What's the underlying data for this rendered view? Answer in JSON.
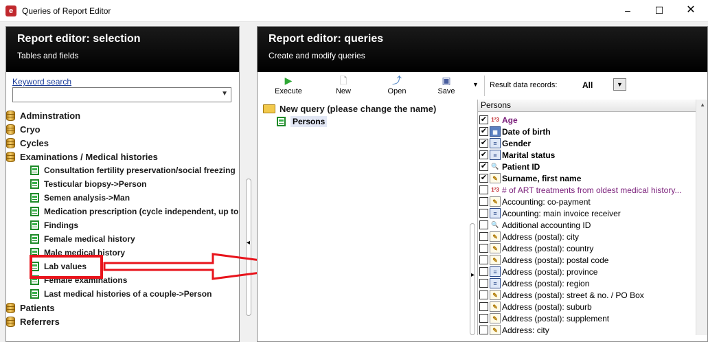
{
  "window": {
    "title": "Queries of Report Editor",
    "minimize": "–",
    "maximize": "☐",
    "close": "✕"
  },
  "left": {
    "title": "Report editor: selection",
    "subtitle": "Tables and fields",
    "keyword_label": "Keyword search",
    "keyword_value": "",
    "tree": [
      {
        "label": "Adminstration",
        "kind": "root"
      },
      {
        "label": "Cryo",
        "kind": "root"
      },
      {
        "label": "Cycles",
        "kind": "root"
      },
      {
        "label": "Examinations / Medical histories",
        "kind": "root"
      },
      {
        "label": "Consultation fertility preservation/social freezing",
        "kind": "child"
      },
      {
        "label": "Testicular biopsy->Person",
        "kind": "child"
      },
      {
        "label": "Semen analysis->Man",
        "kind": "child"
      },
      {
        "label": "Medication prescription (cycle independent, up to",
        "kind": "child"
      },
      {
        "label": "Findings",
        "kind": "child"
      },
      {
        "label": "Female medical history",
        "kind": "child"
      },
      {
        "label": "Male medical history",
        "kind": "child"
      },
      {
        "label": "Lab values",
        "kind": "child"
      },
      {
        "label": "Female examinations",
        "kind": "child"
      },
      {
        "label": "Last medical histories of a couple->Person",
        "kind": "child"
      },
      {
        "label": "Patients",
        "kind": "root"
      },
      {
        "label": "Referrers",
        "kind": "root"
      }
    ]
  },
  "right": {
    "title": "Report editor: queries",
    "subtitle": "Create and modify queries",
    "toolbar": {
      "execute": "Execute",
      "new": "New",
      "open": "Open",
      "save": "Save",
      "result_label": "Result data records:",
      "result_value": "All"
    },
    "query_name": "New query (please change the name)",
    "query_table": "Persons",
    "fields_header": "Persons",
    "fields": [
      {
        "label": "Age",
        "checked": true,
        "icon": "number-icon",
        "style": "bold-purple"
      },
      {
        "label": "Date of birth",
        "checked": true,
        "icon": "date-icon",
        "style": "bold"
      },
      {
        "label": "Gender",
        "checked": true,
        "icon": "list-icon",
        "style": "bold"
      },
      {
        "label": "Marital status",
        "checked": true,
        "icon": "list-icon",
        "style": "bold"
      },
      {
        "label": "Patient ID",
        "checked": true,
        "icon": "key-icon",
        "style": "bold"
      },
      {
        "label": "Surname, first name",
        "checked": true,
        "icon": "text-icon",
        "style": "bold"
      },
      {
        "label": "# of ART treatments from oldest medical history...",
        "checked": false,
        "icon": "number-icon",
        "style": "purple"
      },
      {
        "label": "Accounting: co-payment",
        "checked": false,
        "icon": "text-icon",
        "style": "normal"
      },
      {
        "label": "Acounting: main invoice receiver",
        "checked": false,
        "icon": "list-icon",
        "style": "normal"
      },
      {
        "label": "Additional accounting ID",
        "checked": false,
        "icon": "key-icon",
        "style": "normal"
      },
      {
        "label": "Address (postal): city",
        "checked": false,
        "icon": "text-icon",
        "style": "normal"
      },
      {
        "label": "Address (postal): country",
        "checked": false,
        "icon": "text-icon",
        "style": "normal"
      },
      {
        "label": "Address (postal): postal code",
        "checked": false,
        "icon": "text-icon",
        "style": "normal"
      },
      {
        "label": "Address (postal): province",
        "checked": false,
        "icon": "list-icon",
        "style": "normal"
      },
      {
        "label": "Address (postal): region",
        "checked": false,
        "icon": "list-icon",
        "style": "normal"
      },
      {
        "label": "Address (postal): street & no. / PO Box",
        "checked": false,
        "icon": "text-icon",
        "style": "normal"
      },
      {
        "label": "Address (postal): suburb",
        "checked": false,
        "icon": "text-icon",
        "style": "normal"
      },
      {
        "label": "Address (postal): supplement",
        "checked": false,
        "icon": "text-icon",
        "style": "normal"
      },
      {
        "label": "Address: city",
        "checked": false,
        "icon": "text-icon",
        "style": "normal"
      }
    ]
  },
  "colors": {
    "header_bg": "#000000",
    "highlight": "#e8141c",
    "accent_green": "#2fa836",
    "purple_text": "#7a1e7a"
  }
}
